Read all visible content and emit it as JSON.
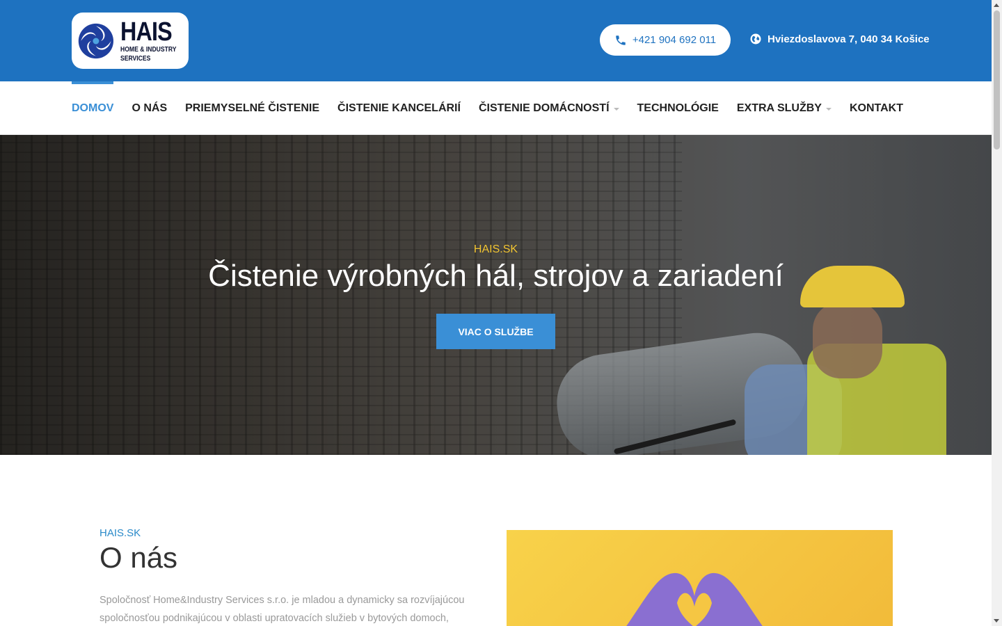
{
  "header": {
    "logo": {
      "wordmark": "HAIS",
      "tagline_line1": "HOME & INDUSTRY",
      "tagline_line2": "SERVICES"
    },
    "phone": {
      "icon": "phone-icon",
      "label": "+421 904 692 011"
    },
    "address": {
      "icon": "globe-icon",
      "label": "Hviezdoslavova 7, 040 34 Košice"
    }
  },
  "nav": {
    "items": [
      {
        "label": "DOMOV",
        "active": true,
        "has_dropdown": false
      },
      {
        "label": "O NÁS",
        "active": false,
        "has_dropdown": false
      },
      {
        "label": "PRIEMYSELNÉ ČISTENIE",
        "active": false,
        "has_dropdown": false
      },
      {
        "label": "ČISTENIE KANCELÁRIÍ",
        "active": false,
        "has_dropdown": false
      },
      {
        "label": "ČISTENIE DOMÁCNOSTÍ",
        "active": false,
        "has_dropdown": true
      },
      {
        "label": "TECHNOLÓGIE",
        "active": false,
        "has_dropdown": false
      },
      {
        "label": "EXTRA SLUŽBY",
        "active": false,
        "has_dropdown": true
      },
      {
        "label": "KONTAKT",
        "active": false,
        "has_dropdown": false
      }
    ]
  },
  "hero": {
    "kicker": "HAIS.SK",
    "title": "Čistenie výrobných hál, strojov a zariadení",
    "button": "VIAC O SLUŽBE"
  },
  "about": {
    "kicker": "HAIS.SK",
    "title": "O nás",
    "text": "Spoločnosť Home&Industry Services s.r.o. je mladou a dynamicky sa rozvíjajúcou spoločnosťou podnikajúcou v oblasti upratovacích služieb v bytových domoch,"
  },
  "colors": {
    "primary": "#1e72c0",
    "accent": "#3a8fd6",
    "highlight": "#f2c531"
  }
}
